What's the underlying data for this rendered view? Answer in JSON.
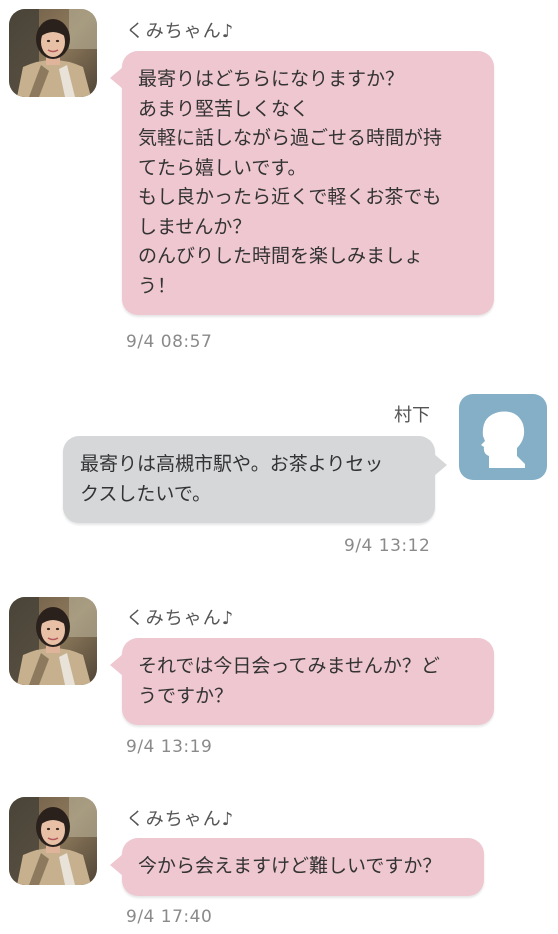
{
  "messages": [
    {
      "sender": "くみちゃん♪",
      "lines": [
        "最寄りはどちらになりますか？",
        "あまり堅苦しくなく",
        "気軽に話しながら過ごせる時間が持",
        "てたら嬉しいです。",
        "もし良かったら近くで軽くお茶でも",
        "しませんか？",
        "のんびりした時間を楽しみましょ",
        "う！"
      ],
      "time": "9/4 08:57"
    },
    {
      "sender": "村下",
      "lines": [
        "最寄りは高槻市駅や。お茶よりセッ",
        "クスしたいで。"
      ],
      "time": "9/4 13:12"
    },
    {
      "sender": "くみちゃん♪",
      "lines": [
        "それでは今日会ってみませんか？ど",
        "うですか？"
      ],
      "time": "9/4 13:19"
    },
    {
      "sender": "くみちゃん♪",
      "lines": [
        "今から会えますけど難しいですか？"
      ],
      "time": "9/4 17:40"
    }
  ],
  "colors": {
    "incoming_bubble": "#efc7d0",
    "outgoing_bubble": "#d5d7d9",
    "self_avatar": "#84afc6"
  },
  "icons": {
    "self_avatar": "silhouette-profile-icon"
  }
}
